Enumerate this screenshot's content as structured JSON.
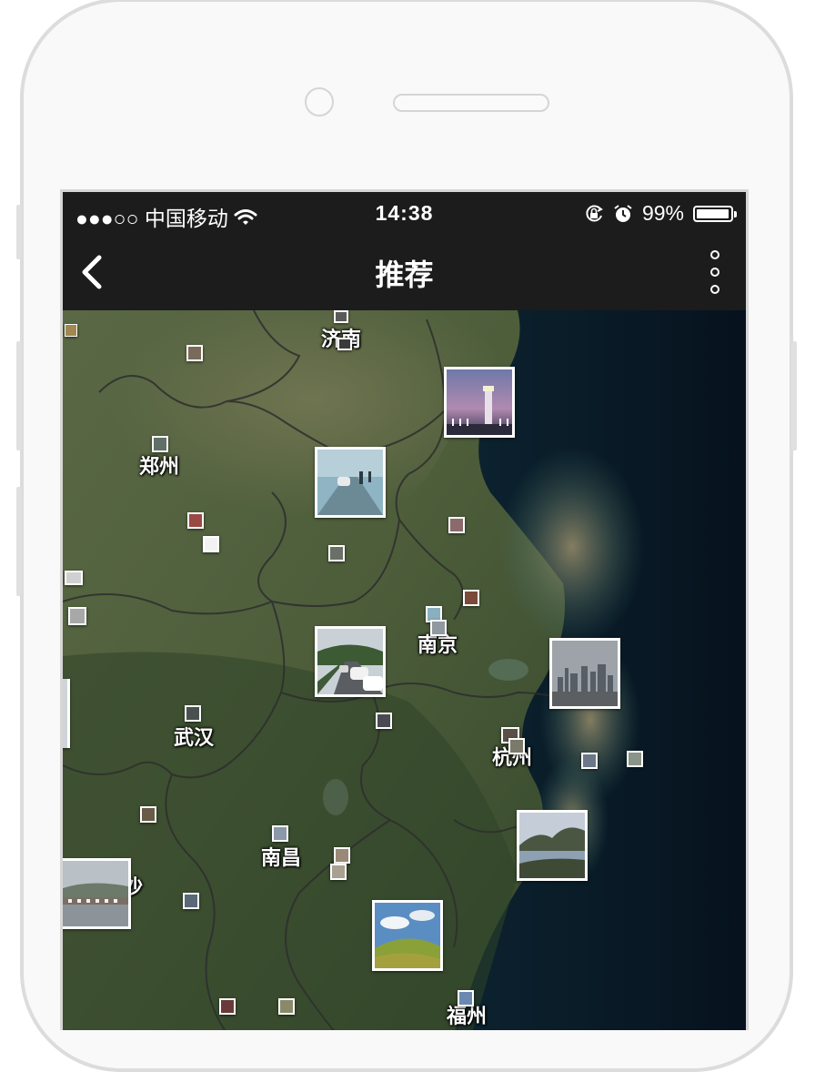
{
  "status_bar": {
    "carrier": "●●●○○ 中国移动",
    "time": "14:38",
    "battery": "99%"
  },
  "nav": {
    "title": "推荐"
  },
  "map": {
    "cities": [
      "济南",
      "郑州",
      "南京",
      "武汉",
      "杭州",
      "南昌",
      "福州",
      "沙"
    ]
  },
  "colors": {
    "bar_background": "#1c1c1c",
    "land": "#4d5d3c",
    "sea": "#0b1e2c",
    "boundary": "#3a3a3a"
  }
}
